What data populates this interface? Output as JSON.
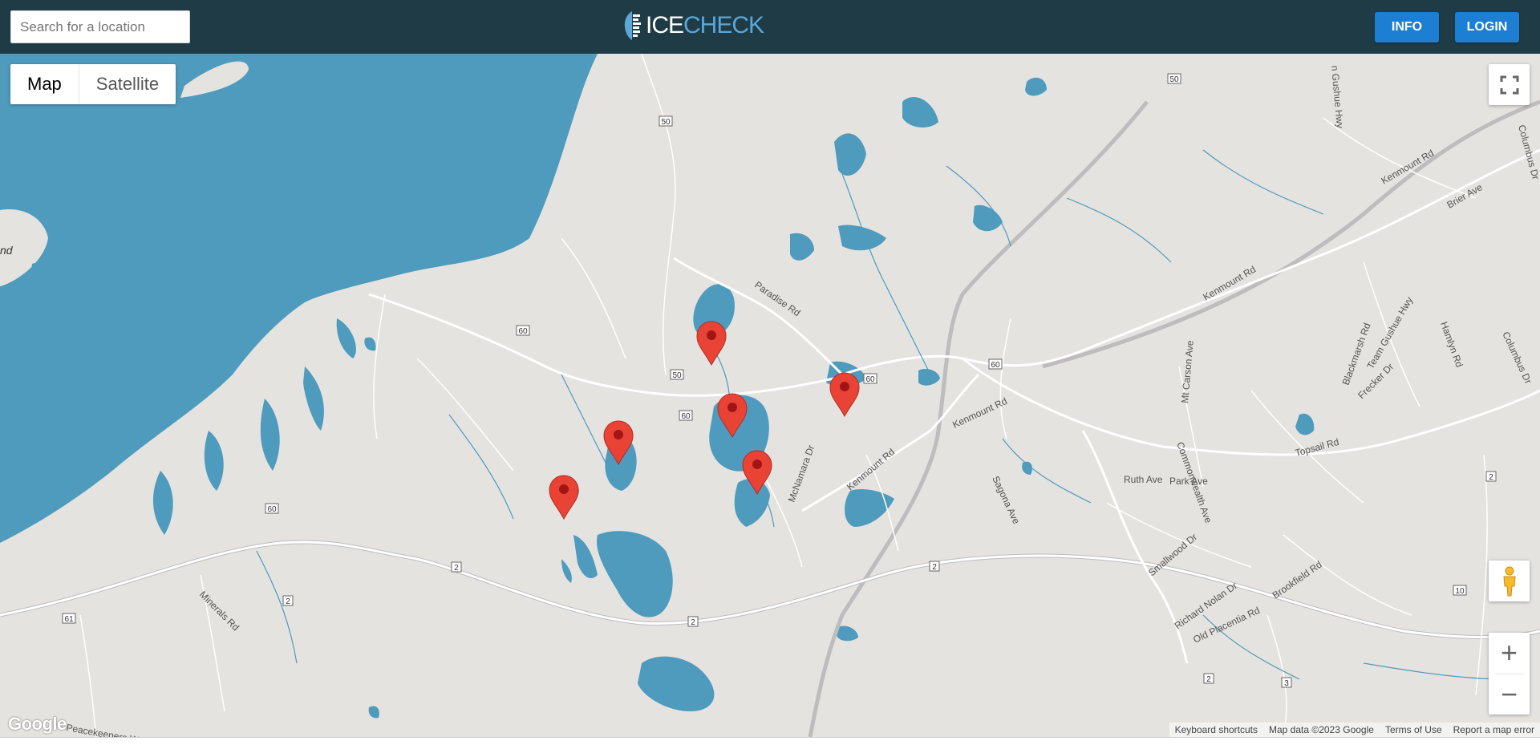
{
  "header": {
    "search_placeholder": "Search for a location",
    "logo_text_1": "ICE",
    "logo_text_2": "CHECK",
    "info_label": "INFO",
    "login_label": "LOGIN"
  },
  "map": {
    "map_type": {
      "map_label": "Map",
      "satellite_label": "Satellite",
      "selected": "Map"
    },
    "zoom_in_label": "+",
    "zoom_out_label": "−",
    "google_logo": "Google",
    "footer": {
      "shortcuts": "Keyboard shortcuts",
      "map_data": "Map data ©2023 Google",
      "terms": "Terms of Use",
      "report": "Report a map error"
    },
    "road_labels": [
      "Paradise Rd",
      "Kenmount Rd",
      "Kenmount Rd",
      "Kenmount Rd",
      "McNamara Dr",
      "Sagona Ave",
      "Commonwealth Ave",
      "Ruth Ave",
      "Park Ave",
      "Smallwood Dr",
      "Richard Nolan Dr",
      "Old Placentia Rd",
      "Brookfield Rd",
      "Topsail Rd",
      "Mt Carson Ave",
      "Blackmarsh Rd",
      "Team Gushue Hwy",
      "Hamlyn Rd",
      "Frecker Dr",
      "Columbus Dr",
      "Columbus Dr",
      "Brier Ave",
      "Minerals Rd",
      "Peacekeepers Way",
      "n Gushue Hwy"
    ],
    "route_shields": [
      "50",
      "50",
      "50",
      "60",
      "60",
      "60",
      "60",
      "2",
      "2",
      "2",
      "2",
      "2",
      "61",
      "10",
      "3",
      "2",
      "60"
    ],
    "water_label": "nd",
    "markers": 6,
    "colors": {
      "water": "#4f9bbd",
      "land": "#e5e3df",
      "marker": "#e94335",
      "header": "#1f3b46",
      "button": "#1d7fd3"
    }
  }
}
